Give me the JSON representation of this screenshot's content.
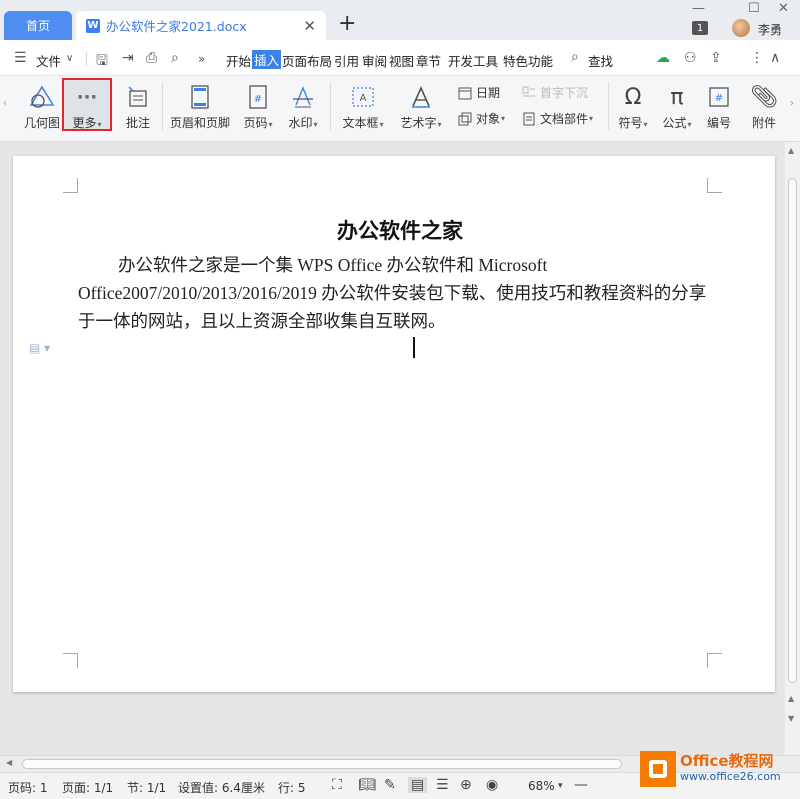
{
  "titlebar": {
    "home_tab": "首页",
    "doc_icon": "W",
    "doc_tab": "办公软件之家2021.docx",
    "close_glyph": "✕",
    "new_tab_glyph": "+",
    "window_badge": "1",
    "username": "李勇"
  },
  "menubar": {
    "file": "文件",
    "items": [
      "开始",
      "插入",
      "页面布局",
      "引用",
      "审阅",
      "视图",
      "章节",
      "开发工具",
      "特色功能"
    ],
    "active_item": "插入",
    "search": "查找"
  },
  "ribbon": {
    "geometry": "几何图",
    "more": "更多",
    "comment": "批注",
    "header_footer": "页眉和页脚",
    "page_number": "页码",
    "watermark": "水印",
    "textbox": "文本框",
    "wordart": "艺术字",
    "date": "日期",
    "object": "对象",
    "dropcap": "首字下沉",
    "doc_parts": "文档部件",
    "symbol": "符号",
    "formula": "公式",
    "numbering": "编号",
    "attachment": "附件"
  },
  "document": {
    "title": "办公软件之家",
    "paragraph": "办公软件之家是一个集 WPS Office 办公软件和 Microsoft Office2007/2010/2013/2016/2019 办公软件安装包下载、使用技巧和教程资料的分享于一体的网站，且以上资源全部收集自互联网。"
  },
  "statusbar": {
    "page_num": "页码: 1",
    "pages": "页面: 1/1",
    "section": "节: 1/1",
    "position": "设置值: 6.4厘米",
    "line": "行: 5",
    "zoom": "68%"
  },
  "watermark": {
    "brand": "Office教程网",
    "url": "www.office26.com"
  },
  "colors": {
    "accent": "#3c83e8",
    "highlight_border": "#e0262b",
    "watermark_orange": "#f57c00"
  }
}
